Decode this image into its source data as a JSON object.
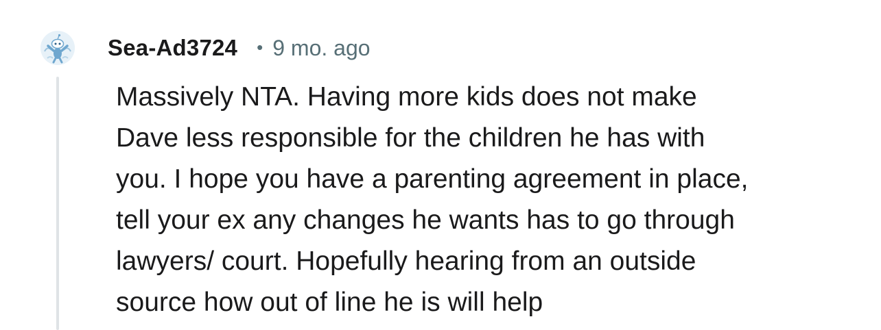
{
  "comment": {
    "author": "Sea-Ad3724",
    "separator": "•",
    "timestamp": "9 mo. ago",
    "avatar_icon": "snoo-avatar-icon",
    "body_lines": [
      "Massively NTA. Having more kids does not make",
      "Dave less responsible for the children he has with",
      "you. I hope you have a parenting agreement in place,",
      "tell your ex any changes he wants has to go through",
      "lawyers/ court. Hopefully hearing from an outside",
      "source how out of line he is will help"
    ]
  },
  "colors": {
    "text": "#1a1a1b",
    "meta": "#576f76",
    "thread_line": "#dfe3e6",
    "avatar_bg": "#e7f1f8"
  }
}
